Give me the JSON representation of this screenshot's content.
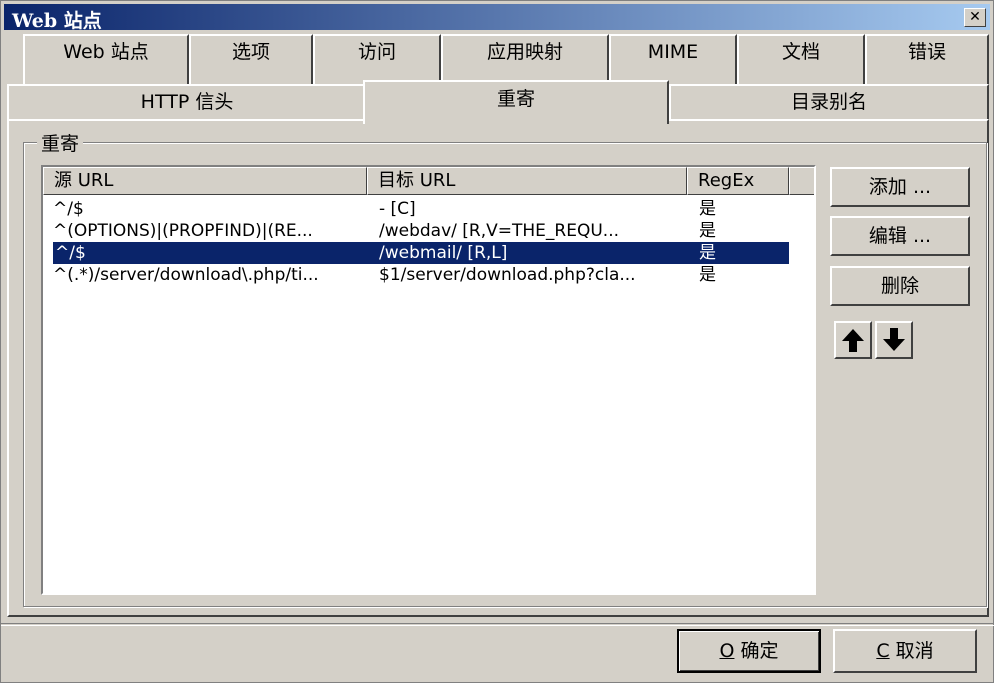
{
  "window": {
    "title": "Web 站点",
    "close_label": "✕"
  },
  "tabs_row1": [
    {
      "label": "Web 站点"
    },
    {
      "label": "选项"
    },
    {
      "label": "访问"
    },
    {
      "label": "应用映射"
    },
    {
      "label": "MIME"
    },
    {
      "label": "文档"
    },
    {
      "label": "错误"
    }
  ],
  "tabs_row2": [
    {
      "label": "HTTP 信头"
    },
    {
      "label": "重寄"
    },
    {
      "label": "目录别名"
    }
  ],
  "group": {
    "label": "重寄"
  },
  "list": {
    "columns": [
      "源 URL",
      "目标 URL",
      "RegEx"
    ],
    "rows": [
      {
        "source": "^/$",
        "target": "- [C]",
        "regex": "是"
      },
      {
        "source": "^(OPTIONS)|(PROPFIND)|(RE...",
        "target": "/webdav/ [R,V=THE_REQU...",
        "regex": "是"
      },
      {
        "source": "^/$",
        "target": "/webmail/ [R,L]",
        "regex": "是"
      },
      {
        "source": "^(.*)/server/download\\.php/ti...",
        "target": "$1/server/download.php?cla...",
        "regex": "是"
      }
    ],
    "selected_index": 2
  },
  "buttons": {
    "add": "添加 ...",
    "edit": "编辑 ...",
    "delete": "删除"
  },
  "footer": {
    "ok_key": "O",
    "ok_text": " 确定",
    "cancel_key": "C",
    "cancel_text": " 取消"
  },
  "icons": {
    "up": "arrow-up-icon",
    "down": "arrow-down-icon"
  }
}
